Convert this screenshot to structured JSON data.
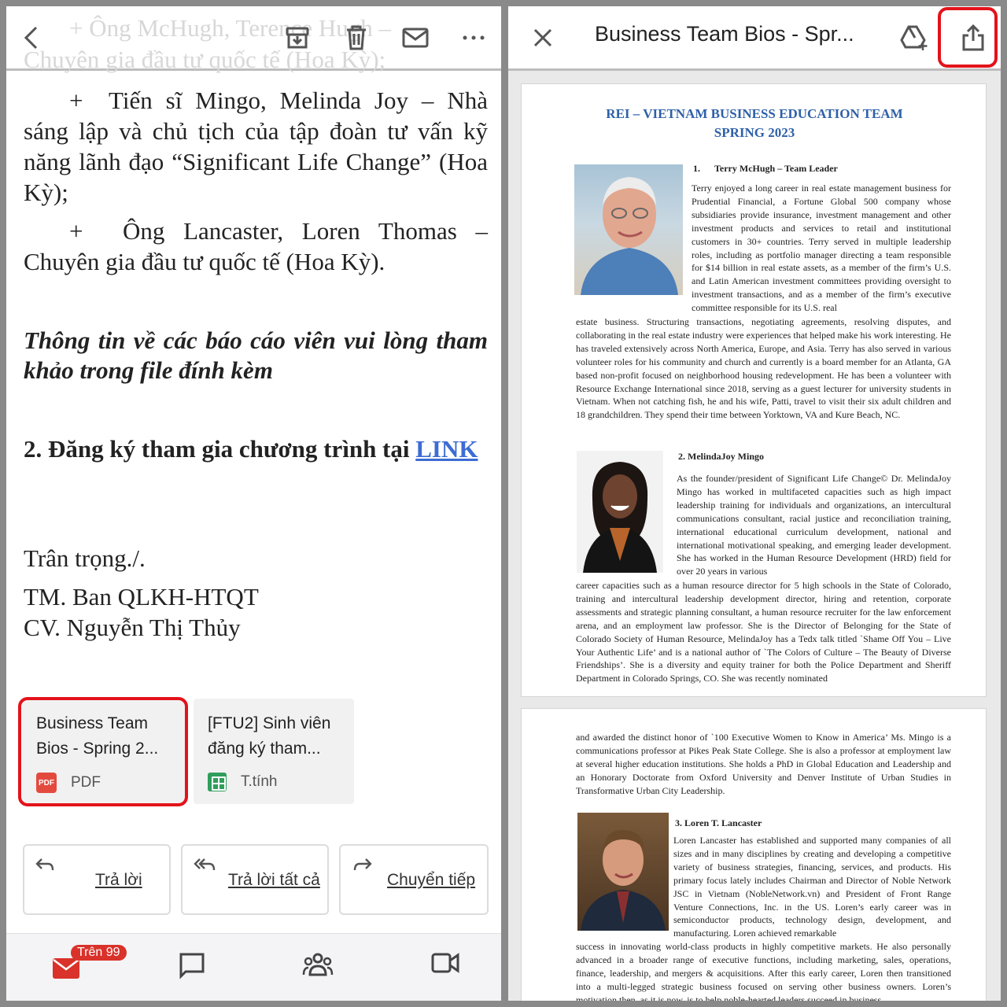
{
  "left": {
    "ghost_text": {
      "line1": "+ Ông McHugh, Terence Hugh –",
      "line2": "Chuyên gia đầu tư quốc tế (Hoa Kỳ);"
    },
    "para1": {
      "bullet": "+",
      "text": "Tiến sĩ Mingo, Melinda Joy – Nhà sáng lập và chủ tịch của tập đoàn tư vấn kỹ năng lãnh đạo “Significant Life Change” (Hoa Kỳ);"
    },
    "para2": {
      "bullet": "+",
      "text": "Ông Lancaster, Loren Thomas – Chuyên gia đầu tư quốc tế (Hoa Kỳ)."
    },
    "italic_note": "Thông tin về các báo cáo viên vui lòng tham khảo trong file đính kèm",
    "register": {
      "text": "2. Đăng ký tham gia chương trình tại",
      "link": "LINK"
    },
    "closing": "Trân trọng./.",
    "sign1": "TM. Ban QLKH-HTQT",
    "sign2": "CV. Nguyễn Thị Thủy",
    "attachments": [
      {
        "title_l1": "Business Team",
        "title_l2": "Bios - Spring 2...",
        "icon_text": "PDF",
        "kind": "PDF"
      },
      {
        "title_l1": "[FTU2] Sinh viên",
        "title_l2": "đăng ký tham...",
        "kind": "T.tính"
      }
    ],
    "actions": {
      "reply": "Trả lời",
      "reply_all": "Trả lời tất cả",
      "forward": "Chuyển tiếp"
    },
    "nav": {
      "badge": "Trên 99"
    }
  },
  "right": {
    "title": "Business Team Bios - Spr...",
    "doc": {
      "title_l1": "REI – VIETNAM BUSINESS EDUCATION TEAM",
      "title_l2": "SPRING 2023",
      "p1_num": "1.",
      "p1_name": "Terry McHugh – Team Leader",
      "p1_bio_a": "Terry enjoyed a long career in real estate management business for Prudential Financial, a Fortune Global 500 company whose subsidiaries provide insurance, investment management and other investment products and services to retail and institutional customers in 30+ countries. Terry served in multiple leadership roles, including as portfolio manager directing a team responsible for $14 billion in real estate assets, as a member of the firm’s U.S. and Latin American investment committees providing oversight to investment transactions, and as a member of the firm’s executive committee responsible for its U.S. real",
      "p1_bio_b": "estate business. Structuring transactions, negotiating agreements, resolving disputes, and collaborating in the real estate industry were experiences that helped make his work interesting. He has traveled extensively across North America, Europe, and Asia. Terry has also served in various volunteer roles for his community and church and currently is a board member for an Atlanta, GA based non-profit focused on neighborhood housing redevelopment. He has been a volunteer with Resource Exchange International since 2018, serving as a guest lecturer for university students in Vietnam. When not catching fish, he and his wife, Patti, travel to visit their six adult children and 18 grandchildren. They spend their time between Yorktown, VA and Kure Beach, NC.",
      "p2_name": "2. MelindaJoy Mingo",
      "p2_bio_a": "As the founder/president of Significant Life Change© Dr. MelindaJoy Mingo has worked in multifaceted capacities such as high impact leadership training for individuals and organizations, an intercultural communications consultant, racial justice and reconciliation training, international educational curriculum development, national and international motivational speaking, and emerging leader development. She has worked in the Human Resource Development (HRD) field for over 20 years in various",
      "p2_bio_b": "career capacities such as a human resource director for 5 high schools in the State of Colorado, training and intercultural leadership development director, hiring and retention, corporate assessments and strategic planning consultant, a human resource recruiter for the law enforcement arena, and an employment law professor. She is the Director of Belonging for the State of Colorado Society of Human Resource, MelindaJoy has a Tedx talk titled `Shame Off You – Live Your Authentic Life’ and is a national author of `The Colors of Culture – The Beauty of Diverse Friendships’. She is a diversity and equity trainer for both the Police Department and Sheriff Department in Colorado Springs, CO. She was recently nominated",
      "p2_bio_c": "and awarded the distinct honor of `100 Executive Women to Know in America’ Ms. Mingo is a communications professor at Pikes Peak State College. She is also a professor at employment law at several higher education institutions. She holds a PhD in Global Education and Leadership and an Honorary Doctorate from Oxford University and Denver Institute of Urban Studies in Transformative Urban City Leadership.",
      "p3_name": "3. Loren T. Lancaster",
      "p3_bio_a": "Loren Lancaster has established and supported many companies of all sizes and in many disciplines by creating and developing a competitive variety of business strategies, financing, services, and products. His primary focus lately includes Chairman and Director of Noble Network JSC in Vietnam (NobleNetwork.vn) and President of Front Range Venture Connections, Inc. in the US. Loren’s early career was in semiconductor products, technology design, development, and manufacturing. Loren achieved remarkable",
      "p3_bio_b": "success in innovating world-class products in highly competitive markets. He also personally advanced in a broader range of executive functions, including marketing, sales, operations, finance, leadership, and mergers & acquisitions. After this early career, Loren then transitioned into a multi-legged strategic business focused on serving other business owners. Loren’s motivation then, as it is now, is to help noble-hearted leaders succeed in business."
    }
  },
  "colors": {
    "highlight": "#e3131b",
    "link": "#3d6cd3",
    "doc_title": "#2e60a8"
  }
}
